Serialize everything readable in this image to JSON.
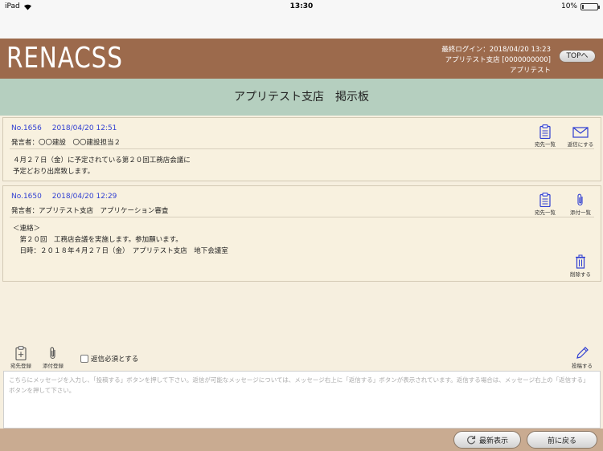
{
  "status_bar": {
    "device": "iPad",
    "time": "13:30",
    "battery": "10%",
    "battery_level": 0.1
  },
  "header": {
    "logo": "RENACSS",
    "last_login": "最終ログイン：2018/04/20 13:23",
    "branch": "アプリテスト支店 [0000000000]",
    "user": "アプリテスト",
    "top_button": "TOPへ"
  },
  "page_title": "アプリテスト支店　掲示板",
  "messages": [
    {
      "number": "No.1656",
      "datetime": "2018/04/20 12:51",
      "speaker": "発言者：〇〇建設　〇〇建設担当２",
      "lines": [
        "４月２７日（金）に予定されている第２０回工務店会議に",
        "予定どおり出席致します。"
      ],
      "tools": [
        "宛先一覧",
        "返信にする"
      ]
    },
    {
      "number": "No.1650",
      "datetime": "2018/04/20 12:29",
      "speaker": "発言者：アプリテスト支店　アプリケーション審査",
      "lines": [
        "＜連絡＞",
        "　第２０回　工務店会議を実施します。参加願います。",
        "　日時：２０１８年４月２７日（金）　アプリテスト支店　地下会議室"
      ],
      "tools": [
        "宛先一覧",
        "添付一覧"
      ],
      "delete_label": "削除する"
    }
  ],
  "toolbar": {
    "recipient_label": "宛先登録",
    "attach_label": "添付登録",
    "reply_required_label": "返信必須とする",
    "post_label": "投稿する"
  },
  "compose": {
    "placeholder": "こちらにメッセージを入力し、「投稿する」ボタンを押して下さい。返信が可能なメッセージについては、メッセージ右上に「返信する」ボタンが表示されています。返信する場合は、メッセージ右上の「返信する」ボタンを押して下さい。"
  },
  "footer": {
    "refresh_label": "最新表示",
    "back_label": "前に戻る"
  }
}
